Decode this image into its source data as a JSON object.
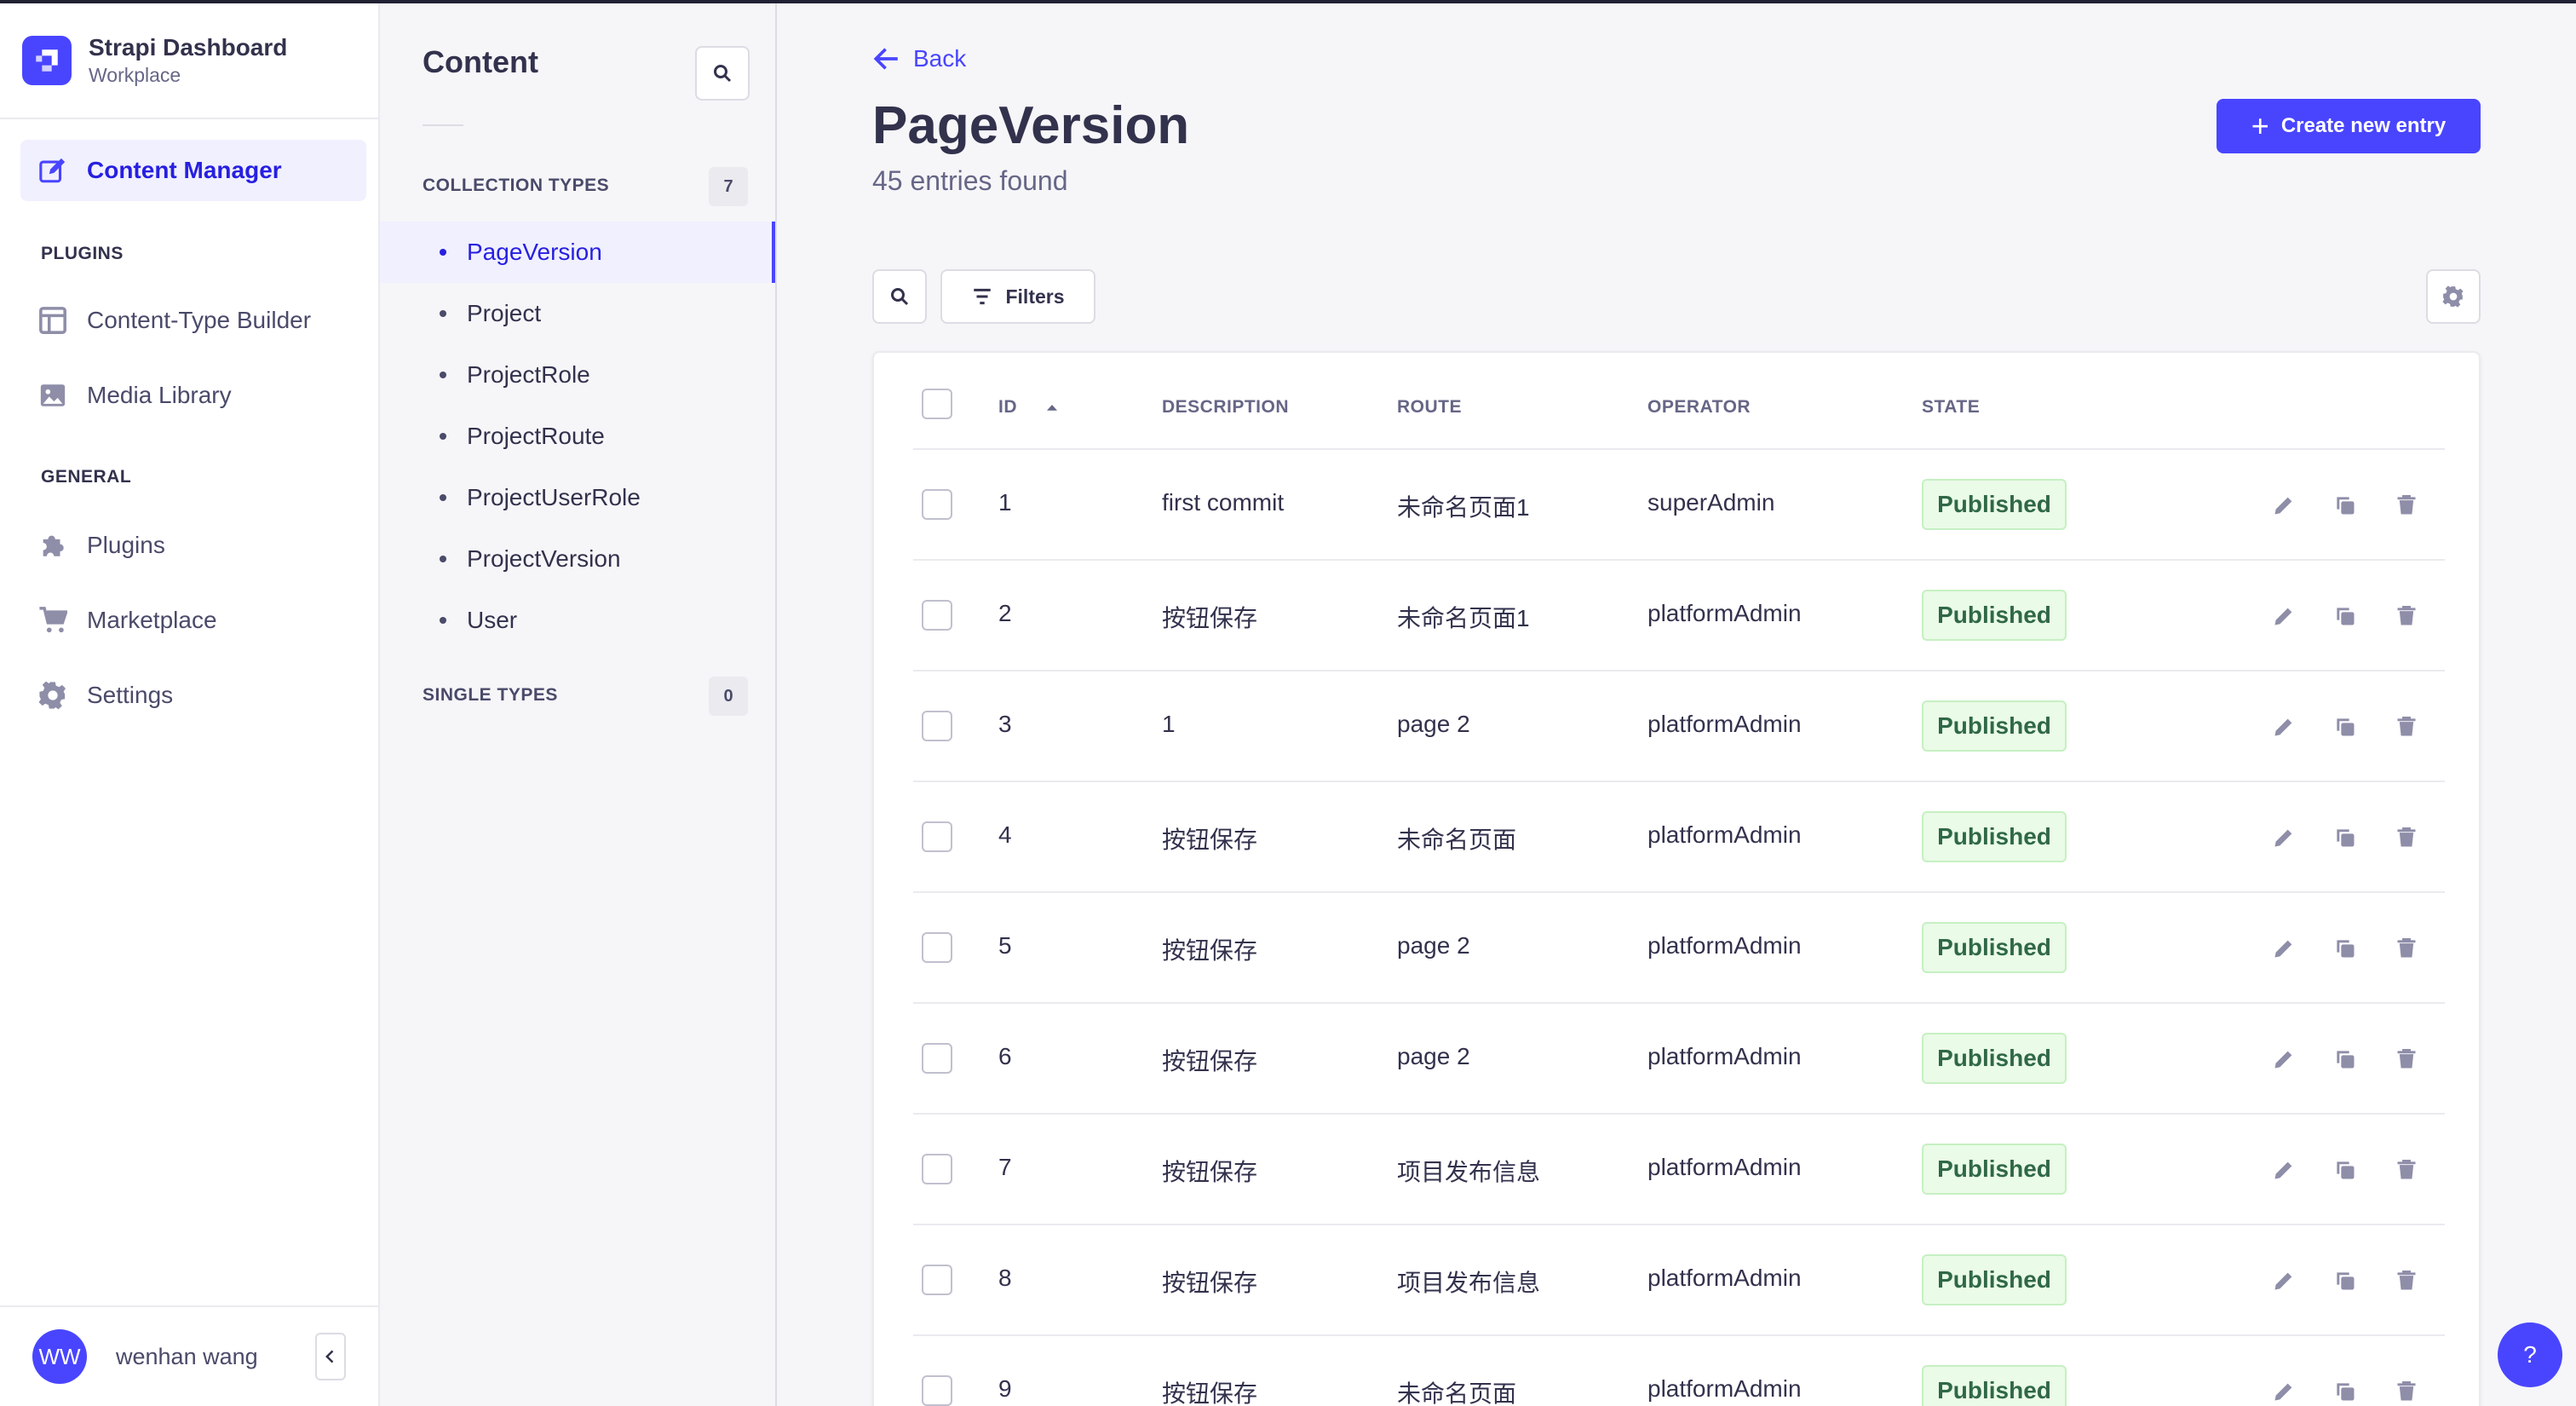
{
  "brand": {
    "title": "Strapi Dashboard",
    "subtitle": "Workplace",
    "logo_icon": "strapi-logo-icon"
  },
  "leftnav": {
    "primary": {
      "label": "Content Manager",
      "icon": "pencil-square-icon"
    },
    "plugins_heading": "PLUGINS",
    "plugins": [
      {
        "label": "Content-Type Builder",
        "icon": "layout-icon"
      },
      {
        "label": "Media Library",
        "icon": "image-icon"
      }
    ],
    "general_heading": "GENERAL",
    "general": [
      {
        "label": "Plugins",
        "icon": "puzzle-icon"
      },
      {
        "label": "Marketplace",
        "icon": "cart-icon"
      },
      {
        "label": "Settings",
        "icon": "gear-icon"
      }
    ]
  },
  "user": {
    "initials": "WW",
    "name": "wenhan wang"
  },
  "subnav": {
    "title": "Content",
    "collection_heading": "COLLECTION TYPES",
    "collection_count": "7",
    "collection_items": [
      "PageVersion",
      "Project",
      "ProjectRole",
      "ProjectRoute",
      "ProjectUserRole",
      "ProjectVersion",
      "User"
    ],
    "single_heading": "SINGLE TYPES",
    "single_count": "0"
  },
  "main": {
    "back_label": "Back",
    "title": "PageVersion",
    "subtitle": "45 entries found",
    "create_label": "Create new entry",
    "filters_label": "Filters"
  },
  "table": {
    "headers": {
      "id": "ID",
      "description": "DESCRIPTION",
      "route": "ROUTE",
      "operator": "OPERATOR",
      "state": "STATE"
    },
    "rows": [
      {
        "id": "1",
        "description": "first commit",
        "route": "未命名页面1",
        "operator": "superAdmin",
        "state": "Published"
      },
      {
        "id": "2",
        "description": "按钮保存",
        "route": "未命名页面1",
        "operator": "platformAdmin",
        "state": "Published"
      },
      {
        "id": "3",
        "description": "1",
        "route": "page 2",
        "operator": "platformAdmin",
        "state": "Published"
      },
      {
        "id": "4",
        "description": "按钮保存",
        "route": "未命名页面",
        "operator": "platformAdmin",
        "state": "Published"
      },
      {
        "id": "5",
        "description": "按钮保存",
        "route": "page 2",
        "operator": "platformAdmin",
        "state": "Published"
      },
      {
        "id": "6",
        "description": "按钮保存",
        "route": "page 2",
        "operator": "platformAdmin",
        "state": "Published"
      },
      {
        "id": "7",
        "description": "按钮保存",
        "route": "项目发布信息",
        "operator": "platformAdmin",
        "state": "Published"
      },
      {
        "id": "8",
        "description": "按钮保存",
        "route": "项目发布信息",
        "operator": "platformAdmin",
        "state": "Published"
      },
      {
        "id": "9",
        "description": "按钮保存",
        "route": "未命名页面",
        "operator": "platformAdmin",
        "state": "Published"
      }
    ]
  },
  "help_label": "?",
  "colors": {
    "accent": "#4945ff",
    "published_bg": "#eafbe7",
    "published_text": "#2f6846"
  }
}
